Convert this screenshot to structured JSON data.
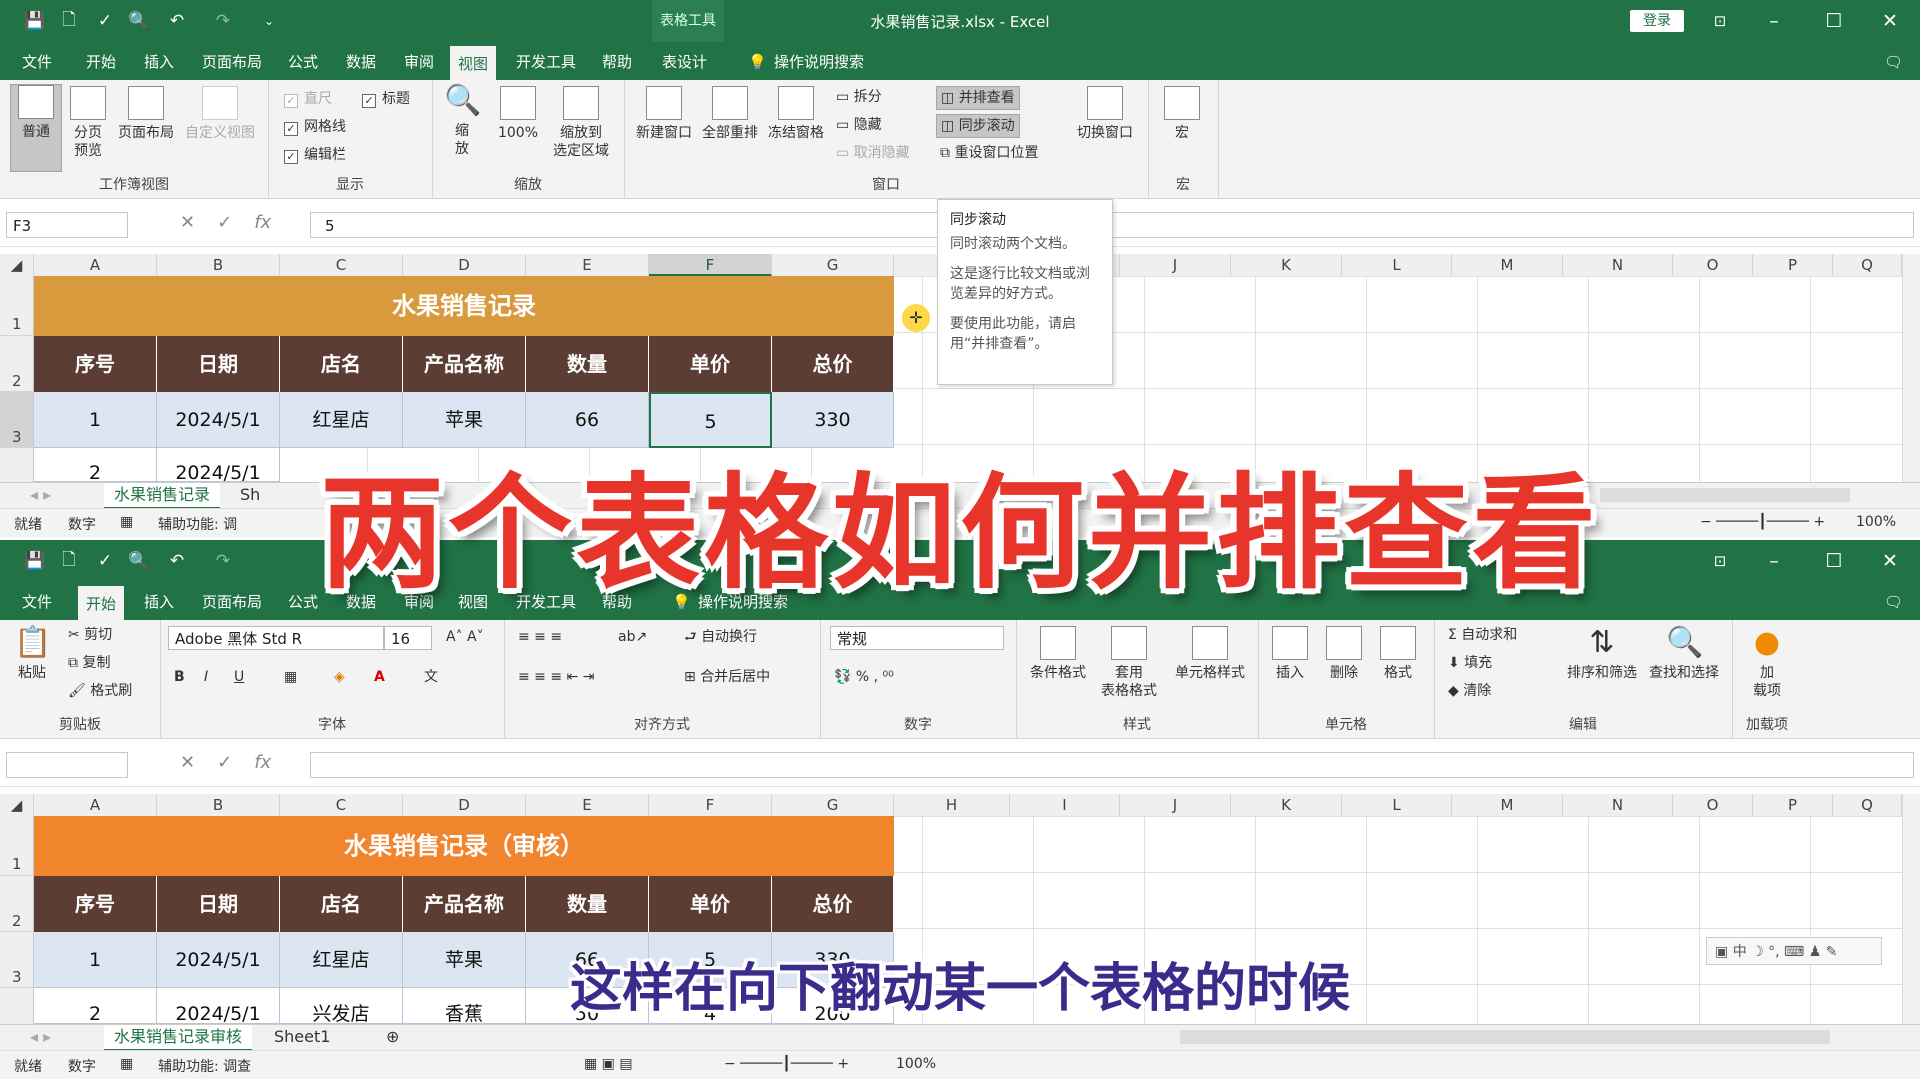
{
  "window1": {
    "title": "水果销售记录.xlsx  -  Excel",
    "context_tab": "表格工具",
    "login": "登录",
    "tabs": [
      "文件",
      "开始",
      "插入",
      "页面布局",
      "公式",
      "数据",
      "审阅",
      "视图",
      "开发工具",
      "帮助",
      "表设计"
    ],
    "active_tab": "视图",
    "search_hint": "操作说明搜索",
    "groups": {
      "workbook_views": {
        "label": "工作簿视图",
        "buttons": [
          "普通",
          "分页\n预览",
          "页面布局",
          "自定义视图"
        ]
      },
      "show": {
        "label": "显示",
        "ruler": "直尺",
        "gridlines": "网格线",
        "formula_bar": "编辑栏",
        "headings": "标题"
      },
      "zoom": {
        "label": "缩放",
        "zoom": "缩\n放",
        "hundred": "100%",
        "zoom_sel": "缩放到\n选定区域"
      },
      "window": {
        "label": "窗口",
        "new_window": "新建窗口",
        "arrange_all": "全部重排",
        "freeze": "冻结窗格",
        "split": "拆分",
        "hide": "隐藏",
        "unhide": "取消隐藏",
        "side_by_side": "并排查看",
        "sync_scroll": "同步滚动",
        "reset_pos": "重设窗口位置",
        "switch": "切换窗口"
      },
      "macros": {
        "label": "宏",
        "macro": "宏"
      }
    },
    "namebox": "F3",
    "formula": "5",
    "columns": [
      "A",
      "B",
      "C",
      "D",
      "E",
      "F",
      "G",
      "H",
      "I",
      "J",
      "K",
      "L",
      "M",
      "N",
      "O",
      "P",
      "Q"
    ],
    "rows": [
      "1",
      "2",
      "3"
    ],
    "table_title": "水果销售记录",
    "headers": [
      "序号",
      "日期",
      "店名",
      "产品名称",
      "数量",
      "单价",
      "总价"
    ],
    "data_rows": [
      [
        "1",
        "2024/5/1",
        "红星店",
        "苹果",
        "66",
        "5",
        "330"
      ],
      [
        "2",
        "2024/5/1",
        "",
        "",
        "",
        "",
        ""
      ]
    ],
    "sheets": [
      "水果销售记录",
      "Sh"
    ],
    "status": {
      "ready": "就绪",
      "mode": "数字",
      "access": "辅助功能: 调",
      "zoom": "100%"
    },
    "tooltip": {
      "title": "同步滚动",
      "p1": "同时滚动两个文档。",
      "p2": "这是逐行比较文档或浏览差异的好方式。",
      "p3": "要使用此功能，请启用“并排查看”。"
    }
  },
  "window2": {
    "tabs": [
      "文件",
      "开始",
      "插入",
      "页面布局",
      "公式",
      "数据",
      "审阅",
      "视图",
      "开发工具",
      "帮助"
    ],
    "active_tab": "开始",
    "search_hint": "操作说明搜索",
    "clipboard": {
      "label": "剪贴板",
      "paste": "粘贴",
      "cut": "剪切",
      "copy": "复制",
      "painter": "格式刷"
    },
    "font": {
      "label": "字体",
      "name": "Adobe 黑体 Std R",
      "size": "16",
      "bold": "B",
      "italic": "I",
      "underline": "U"
    },
    "alignment": {
      "label": "对齐方式",
      "wrap": "自动换行",
      "merge": "合并后居中"
    },
    "number": {
      "label": "数字",
      "format": "常规"
    },
    "styles": {
      "label": "样式",
      "cond": "条件格式",
      "table": "套用\n表格格式",
      "cell": "单元格样式"
    },
    "cells": {
      "label": "单元格",
      "insert": "插入",
      "delete": "删除",
      "format": "格式"
    },
    "editing": {
      "label": "编辑",
      "autosum": "自动求和",
      "fill": "填充",
      "clear": "清除",
      "sort": "排序和筛选",
      "find": "查找和选择"
    },
    "addins": {
      "label": "加载项",
      "btn": "加\n载项"
    },
    "columns": [
      "A",
      "B",
      "C",
      "D",
      "E",
      "F",
      "G",
      "H",
      "I",
      "J",
      "K",
      "L",
      "M",
      "N",
      "O",
      "P",
      "Q"
    ],
    "rows": [
      "1",
      "2",
      "3"
    ],
    "table_title": "水果销售记录（审核）",
    "headers": [
      "序号",
      "日期",
      "店名",
      "产品名称",
      "数量",
      "单价",
      "总价"
    ],
    "data_rows": [
      [
        "1",
        "2024/5/1",
        "红星店",
        "苹果",
        "66",
        "5",
        "330"
      ],
      [
        "2",
        "2024/5/1",
        "兴发店",
        "香蕉",
        "50",
        "4",
        "200"
      ]
    ],
    "sheets": [
      "水果销售记录审核",
      "Sheet1"
    ],
    "status": {
      "ready": "就绪",
      "mode": "数字",
      "access": "辅助功能: 调查",
      "zoom": "100%"
    },
    "ime": "中"
  },
  "overlay": {
    "title": "两个表格如何并排查看",
    "subtitle": "这样在向下翻动某一个表格的时候"
  },
  "colors": {
    "excel_green": "#217346",
    "header_brown": "#5b3d33",
    "title_orange1": "#d99a3e",
    "title_orange2": "#f0852d",
    "row_blue": "#dce6f3",
    "overlay_red": "#e8352b"
  }
}
